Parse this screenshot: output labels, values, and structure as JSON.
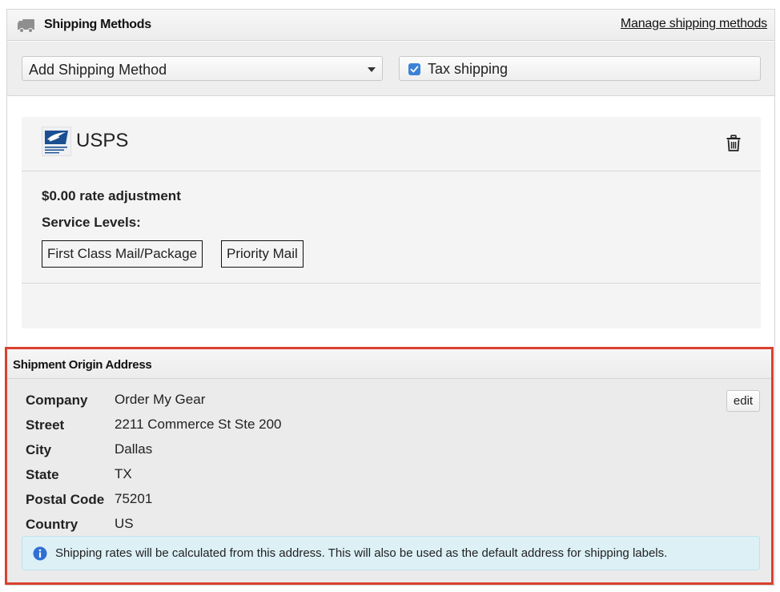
{
  "shipping_methods": {
    "title": "Shipping Methods",
    "manage_link": "Manage shipping methods",
    "add_method_select": {
      "selected": "Add Shipping Method"
    },
    "tax_shipping": {
      "label": "Tax shipping",
      "checked": true
    }
  },
  "method_card": {
    "carrier_name": "USPS",
    "logo_text": "UNITED STATES POSTAL SERVICE",
    "rate_adjustment": "$0.00 rate adjustment",
    "service_levels_label": "Service Levels:",
    "service_levels": [
      "First Class Mail/Package",
      "Priority Mail"
    ]
  },
  "origin_address": {
    "title": "Shipment Origin Address",
    "edit_label": "edit",
    "rows": [
      {
        "label": "Company",
        "value": "Order My Gear"
      },
      {
        "label": "Street",
        "value": "2211 Commerce St Ste 200"
      },
      {
        "label": "City",
        "value": "Dallas"
      },
      {
        "label": "State",
        "value": "TX"
      },
      {
        "label": "Postal Code",
        "value": "75201"
      },
      {
        "label": "Country",
        "value": "US"
      }
    ],
    "info_text": "Shipping rates will be calculated from this address. This will also be used as the default address for shipping labels."
  },
  "colors": {
    "highlight_border": "#d9412e",
    "checkbox_blue": "#3b82d6",
    "info_background": "#dcf0f6",
    "info_icon_blue": "#2f6fd6",
    "usps_blue": "#1c4f91"
  },
  "icons": {
    "header": "truck-icon",
    "delete": "trash-icon",
    "info": "info-icon",
    "logo": "usps-eagle-logo"
  }
}
